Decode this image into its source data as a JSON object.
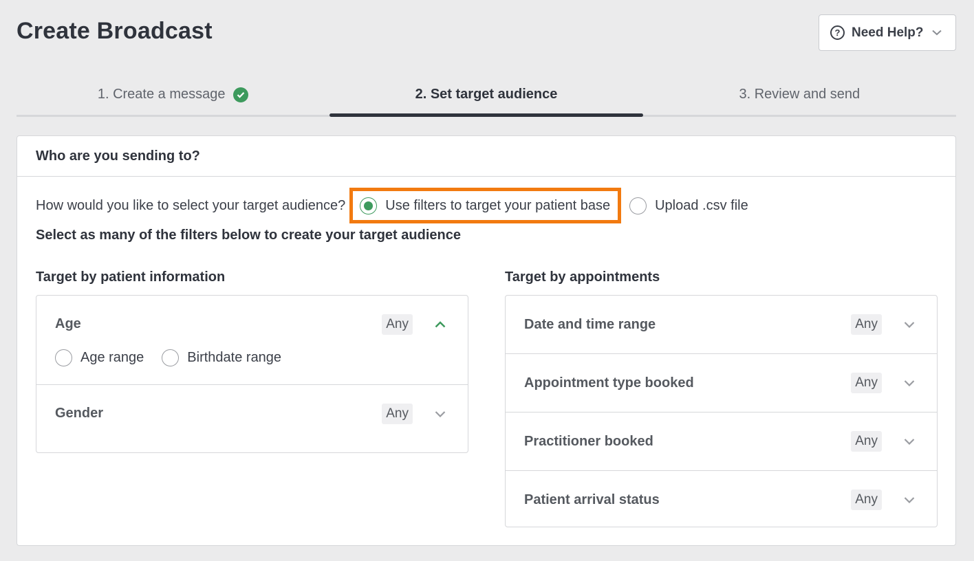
{
  "page": {
    "title": "Create Broadcast",
    "help_label": "Need Help?"
  },
  "steps": [
    {
      "label": "1. Create a message",
      "state": "complete"
    },
    {
      "label": "2. Set target audience",
      "state": "active"
    },
    {
      "label": "3. Review and send",
      "state": "upcoming"
    }
  ],
  "card": {
    "header": "Who are you sending to?",
    "question": "How would you like to select your target audience?",
    "options": [
      {
        "label": "Use filters to target your patient base",
        "selected": true
      },
      {
        "label": "Upload .csv file",
        "selected": false
      }
    ],
    "instruction": "Select as many of the filters below to create your target audience"
  },
  "patient_info": {
    "title": "Target by patient information",
    "filters": [
      {
        "label": "Age",
        "badge": "Any",
        "expanded": true,
        "sub_options": [
          "Age range",
          "Birthdate range"
        ]
      },
      {
        "label": "Gender",
        "badge": "Any",
        "expanded": false
      }
    ]
  },
  "appointments": {
    "title": "Target by appointments",
    "filters": [
      {
        "label": "Date and time range",
        "badge": "Any"
      },
      {
        "label": "Appointment type booked",
        "badge": "Any"
      },
      {
        "label": "Practitioner booked",
        "badge": "Any"
      },
      {
        "label": "Patient arrival status",
        "badge": "Any"
      }
    ]
  },
  "colors": {
    "accent_green": "#3d9a5d",
    "highlight_orange": "#f27a10",
    "text_dark": "#2f333c",
    "background": "#ebebec"
  }
}
